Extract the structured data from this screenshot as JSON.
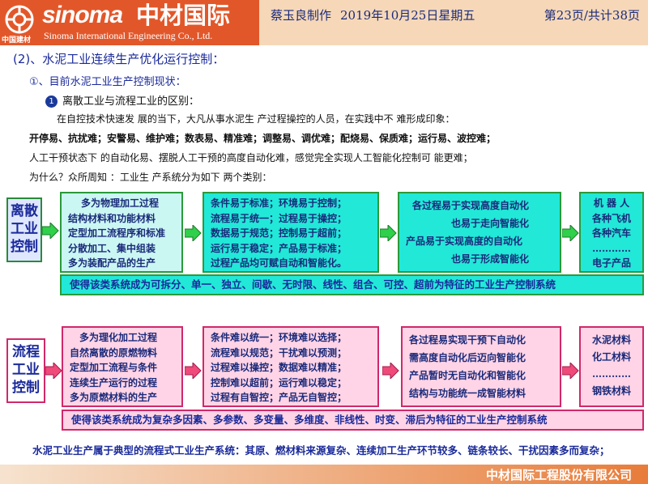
{
  "header": {
    "logo_en": "sinoma",
    "logo_cn": "中材国际",
    "logo_full": "Sinoma International Engineering  Co., Ltd.",
    "logo_sub": "中国建材",
    "author": "蔡玉良制作",
    "date": "2019年10月25日星期五",
    "page": "第23页/共计38页",
    "brand_color": "#e2572a"
  },
  "section_title": "(2)、水泥工业连续生产优化运行控制：",
  "subsection_title": "①、目前水泥工业生产控制现状：",
  "bullet": {
    "num": "1",
    "text": "离散工业与流程工业的区别："
  },
  "paragraphs": [
    "在自控技术快速发 展的当下，大凡从事水泥生 产过程操控的人员，在实践中不 难形成印象：",
    "开停易、抗扰难；安警易、维护难；数表易、精准难；调整易、调优难；配烧易、保质难；运行易、波控难；",
    "人工干预状态下 的自动化易、摆脱人工干预的高度自动化难，感觉完全实现人工智能化控制可 能更难；",
    "为什么？众所周知 ：工业生 产系统分为如下 两个类别："
  ],
  "discrete": {
    "label": [
      "离散",
      "工业",
      "控制"
    ],
    "box1": [
      "多为物理加工过程",
      "结构材料和功能材料",
      "定型加工流程序和标准",
      "分散加工、集中组装",
      "多为装配产品的生产"
    ],
    "box2": [
      "条件易于标准；环境易于控制；",
      "流程易于统一；过程易于操控；",
      "数据易于规范；控制易于超前；",
      "运行易于稳定；产品易于标准；",
      "过程产品均可赋自动和智能化。"
    ],
    "box3": [
      "各过程易于实现高度自动化",
      "也易于走向智能化",
      "产品易于实现高度的自动化",
      "也易于形成智能化"
    ],
    "box4": [
      "机 器 人",
      "各种飞机",
      "各种汽车",
      "…………",
      "电子产品"
    ],
    "bar": "使得该类系统成为可拆分、单一、独立、间歇、无时限、线性、组合、可控、超前为特征的工业生产控制系统"
  },
  "process": {
    "label": [
      "流程",
      "工业",
      "控制"
    ],
    "box1": [
      "多为理化加工过程",
      "自然离散的原燃物料",
      "定型加工流程与条件",
      "连续生产运行的过程",
      "多为原燃材料的生产"
    ],
    "box2": [
      "条件难以统一；环境难以选择；",
      "流程难以规范；干扰难以预测；",
      "过程难以操控；数据难以精准；",
      "控制难以超前；运行难以稳定；",
      "过程有自智控；产品无自智控；"
    ],
    "box3": [
      "各过程易实现干预下自动化",
      "需高度自动化后迈向智能化",
      "产品暂时无自动化和智能化",
      "结构与功能统一成智能材料"
    ],
    "box4": [
      "水泥材料",
      "化工材料",
      "…………",
      "钢铁材料"
    ],
    "bar": "使得该类系统成为复杂多因素、多参数、多变量、多维度、非线性、时变、滞后为特征的工业生产控制系统"
  },
  "footer_note": "水泥工业生产属于典型的流程式工业生产系统：其原、燃材料来源复杂、连续加工生产环节较多、链条较长、干扰因素多而复杂；",
  "footer_company": "中材国际工程股份有限公司"
}
